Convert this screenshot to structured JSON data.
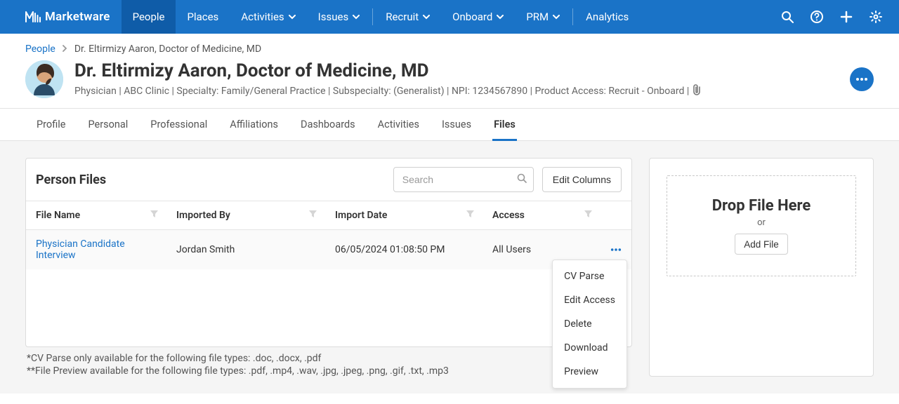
{
  "brand": "Marketware",
  "nav": {
    "items": [
      {
        "label": "People",
        "active": true,
        "hasMenu": false
      },
      {
        "label": "Places",
        "active": false,
        "hasMenu": false
      },
      {
        "label": "Activities",
        "active": false,
        "hasMenu": true
      },
      {
        "label": "Issues",
        "active": false,
        "hasMenu": true
      },
      {
        "label": "Recruit",
        "active": false,
        "hasMenu": true,
        "dividerBefore": true
      },
      {
        "label": "Onboard",
        "active": false,
        "hasMenu": true
      },
      {
        "label": "PRM",
        "active": false,
        "hasMenu": true
      },
      {
        "label": "Analytics",
        "active": false,
        "hasMenu": false,
        "dividerBefore": true
      }
    ]
  },
  "breadcrumb": {
    "root": "People",
    "current": "Dr. Eltirmizy Aaron, Doctor of Medicine, MD"
  },
  "person": {
    "name": "Dr. Eltirmizy Aaron, Doctor of Medicine, MD",
    "meta": "Physician | ABC Clinic | Specialty: Family/General Practice | Subspecialty: (Generalist) | NPI: 1234567890 | Product Access: Recruit - Onboard |"
  },
  "tabs": [
    {
      "label": "Profile",
      "active": false
    },
    {
      "label": "Personal",
      "active": false
    },
    {
      "label": "Professional",
      "active": false
    },
    {
      "label": "Affiliations",
      "active": false
    },
    {
      "label": "Dashboards",
      "active": false
    },
    {
      "label": "Activities",
      "active": false
    },
    {
      "label": "Issues",
      "active": false
    },
    {
      "label": "Files",
      "active": true
    }
  ],
  "filesPanel": {
    "title": "Person Files",
    "search_placeholder": "Search",
    "edit_columns_label": "Edit Columns",
    "columns": {
      "file_name": "File Name",
      "imported_by": "Imported By",
      "import_date": "Import Date",
      "access": "Access"
    },
    "rows": [
      {
        "file_name": "Physician Candidate Interview",
        "imported_by": "Jordan Smith",
        "import_date": "06/05/2024 01:08:50 PM",
        "access": "All Users"
      }
    ],
    "footnote1": "*CV Parse only available for the following file types: .doc, .docx, .pdf",
    "footnote2": "**File Preview available for the following file types: .pdf, .mp4, .wav, .jpg, .jpeg, .png, .gif, .txt, .mp3"
  },
  "rowMenu": {
    "items": [
      {
        "label": "CV Parse"
      },
      {
        "label": "Edit Access"
      },
      {
        "label": "Delete"
      },
      {
        "label": "Download"
      },
      {
        "label": "Preview"
      }
    ]
  },
  "dropZone": {
    "title": "Drop File Here",
    "or": "or",
    "add_file_label": "Add File"
  }
}
